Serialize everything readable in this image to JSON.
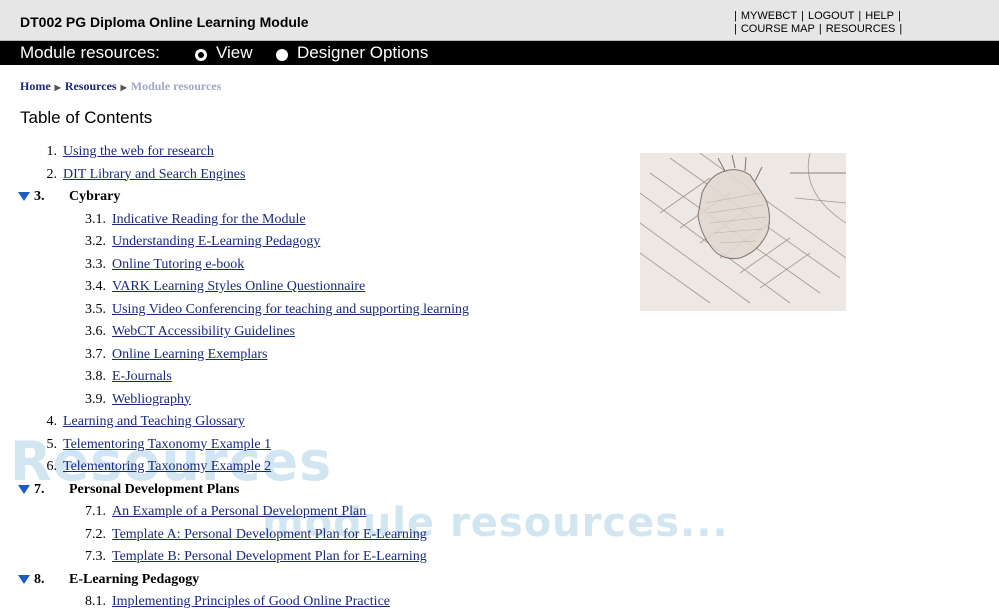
{
  "header": {
    "course_title": "DT002 PG Diploma Online Learning Module",
    "links_row1": [
      "MYWEBCT",
      "LOGOUT",
      "HELP"
    ],
    "links_row2": [
      "COURSE MAP",
      "RESOURCES"
    ]
  },
  "modebar": {
    "label": "Module resources:",
    "view_label": "View",
    "designer_label": "Designer Options",
    "selected": "View"
  },
  "breadcrumb": {
    "home": "Home",
    "resources": "Resources",
    "current": "Module resources"
  },
  "toc": {
    "title": "Table of Contents",
    "items": [
      {
        "num": "1.",
        "label": "Using the web for research",
        "level": 1,
        "type": "link"
      },
      {
        "num": "2.",
        "label": "DIT Library and Search Engines",
        "level": 1,
        "type": "link"
      },
      {
        "num": "3.",
        "label": "Cybrary",
        "level": 1,
        "type": "section"
      },
      {
        "num": "3.1.",
        "label": "Indicative Reading for the Module",
        "level": 2,
        "type": "link"
      },
      {
        "num": "3.2.",
        "label": "Understanding E-Learning Pedagogy",
        "level": 2,
        "type": "link"
      },
      {
        "num": "3.3.",
        "label": "Online Tutoring e-book",
        "level": 2,
        "type": "link"
      },
      {
        "num": "3.4.",
        "label": "VARK Learning Styles Online Questionnaire",
        "level": 2,
        "type": "link"
      },
      {
        "num": "3.5.",
        "label": "Using Video Conferencing for teaching and supporting learning",
        "level": 2,
        "type": "link"
      },
      {
        "num": "3.6.",
        "label": "WebCT Accessibility Guidelines",
        "level": 2,
        "type": "link"
      },
      {
        "num": "3.7.",
        "label": "Online Learning Exemplars",
        "level": 2,
        "type": "link"
      },
      {
        "num": "3.8.",
        "label": "E-Journals",
        "level": 2,
        "type": "link"
      },
      {
        "num": "3.9.",
        "label": "Webliography",
        "level": 2,
        "type": "link"
      },
      {
        "num": "4.",
        "label": "Learning and Teaching Glossary",
        "level": 1,
        "type": "link"
      },
      {
        "num": "5.",
        "label": "Telementoring Taxonomy Example 1",
        "level": 1,
        "type": "link"
      },
      {
        "num": "6.",
        "label": "Telementoring Taxonomy Example 2",
        "level": 1,
        "type": "link"
      },
      {
        "num": "7.",
        "label": "Personal Development Plans",
        "level": 1,
        "type": "section"
      },
      {
        "num": "7.1.",
        "label": "An Example of a Personal Development Plan",
        "level": 2,
        "type": "link"
      },
      {
        "num": "7.2.",
        "label": "Template A: Personal Development Plan for E-Learning",
        "level": 2,
        "type": "link"
      },
      {
        "num": "7.3.",
        "label": "Template B: Personal Development Plan for E-Learning",
        "level": 2,
        "type": "link"
      },
      {
        "num": "8.",
        "label": "E-Learning Pedagogy",
        "level": 1,
        "type": "section"
      },
      {
        "num": "8.1.",
        "label": "Implementing Principles of Good Online Practice",
        "level": 2,
        "type": "link"
      }
    ]
  },
  "watermark": {
    "line1": "Resources",
    "line2": "module resources..."
  },
  "colors": {
    "link": "#1a2a7a",
    "triangle": "#1a5bc4",
    "modebar_bg": "#000000",
    "topbar_bg": "#e6e6e6",
    "watermark": "#d2e6f2"
  }
}
